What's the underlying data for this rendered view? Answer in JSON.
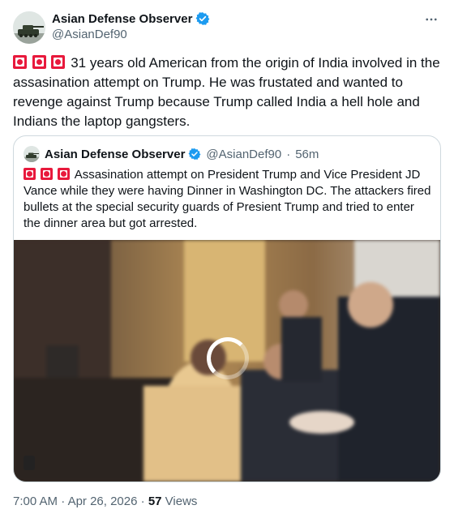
{
  "author": {
    "name": "Asian Defense Observer",
    "handle": "@AsianDef90",
    "verified": true,
    "avatar_icon": "tank-icon"
  },
  "menu_icon": "more-horizontal-icon",
  "tweet": {
    "text": "31 years old American from the origin of India involved in the assasination attempt on Trump. He was frustated and wanted to revenge against Trump because Trump called India a hell hole and Indians the laptop gangsters."
  },
  "quoted": {
    "name": "Asian Defense Observer",
    "handle": "@AsianDef90",
    "separator": "·",
    "time_ago": "56m",
    "text": "Assasination attempt on President Trump and Vice President JD Vance while they were having Dinner in Washington DC. The attackers fired bullets at the special security guards of Presient Trump and tried to enter the dinner area  but  got arrested."
  },
  "footer": {
    "time": "7:00 AM",
    "separator": "·",
    "date": "Apr 26, 2026",
    "views_count": "57",
    "views_label": "Views"
  },
  "colors": {
    "text": "#0f1419",
    "secondary": "#536471",
    "verified": "#1d9bf0",
    "border": "#cfd9de",
    "siren_red": "#e8193c"
  }
}
